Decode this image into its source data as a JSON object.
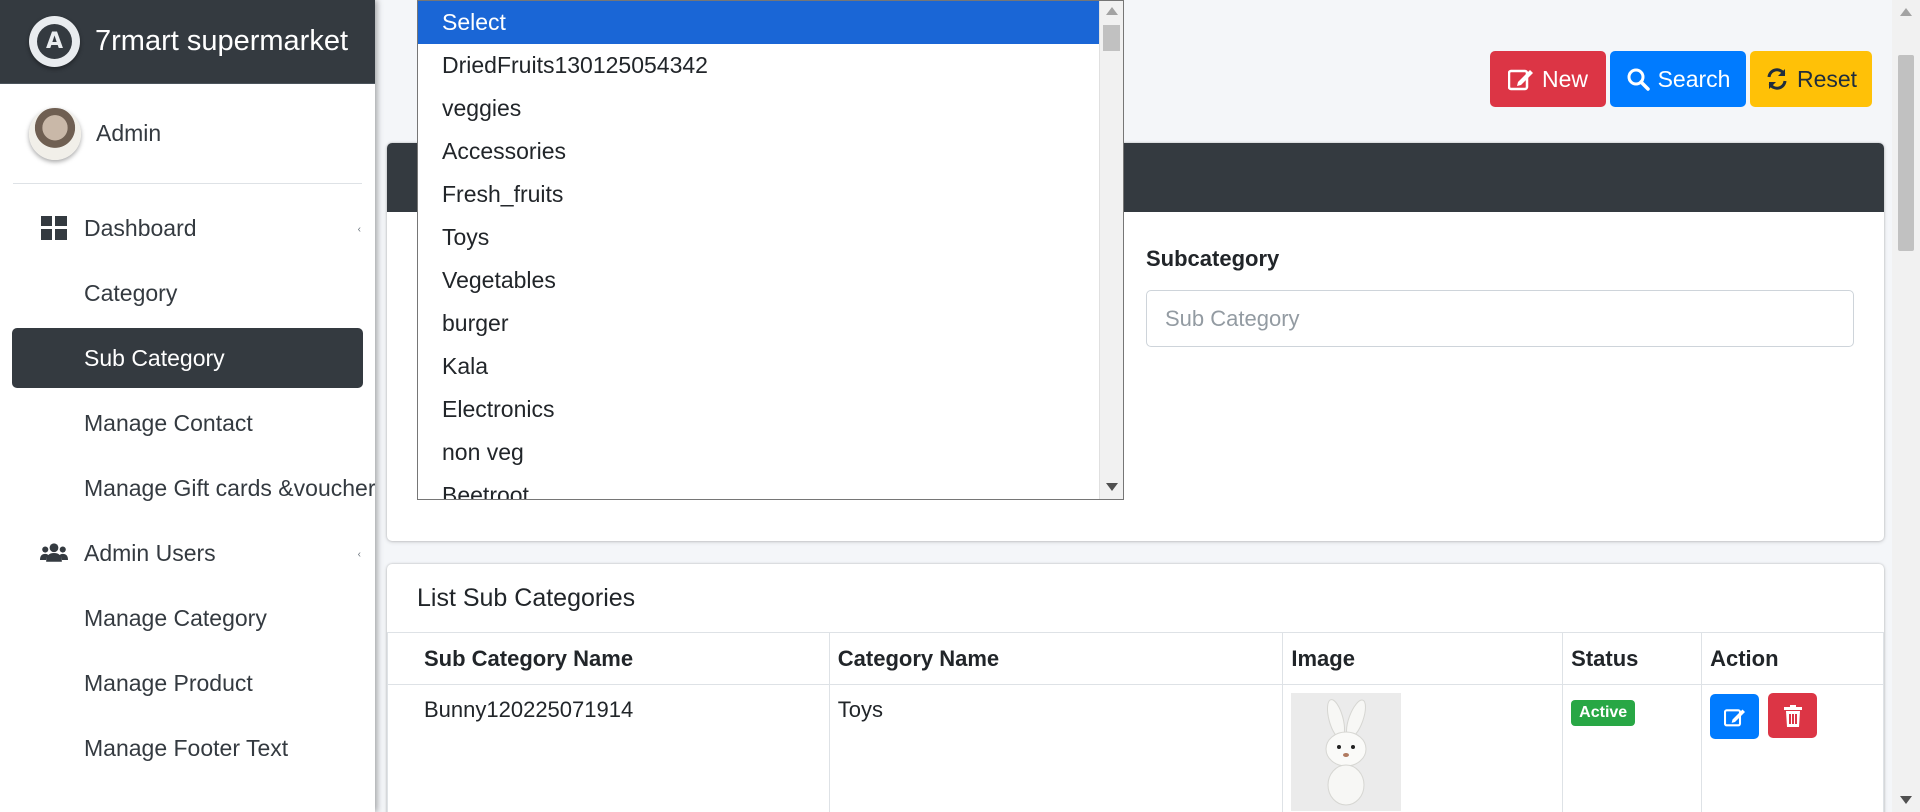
{
  "brand": {
    "name": "7rmart supermarket",
    "logo_letter": "A"
  },
  "user": {
    "name": "Admin"
  },
  "sidebar": {
    "items": [
      {
        "label": "Dashboard",
        "icon": "dashboard-icon",
        "level": "top"
      },
      {
        "label": "Category",
        "level": "sub"
      },
      {
        "label": "Sub Category",
        "level": "sub",
        "active": true
      },
      {
        "label": "Manage Contact",
        "level": "sub"
      },
      {
        "label": "Manage Gift cards &voucher",
        "level": "sub"
      },
      {
        "label": "Admin Users",
        "icon": "users-icon",
        "level": "top"
      },
      {
        "label": "Manage Category",
        "level": "sub"
      },
      {
        "label": "Manage Product",
        "level": "sub"
      },
      {
        "label": "Manage Footer Text",
        "level": "sub"
      }
    ]
  },
  "toolbar": {
    "new_label": "New",
    "search_label": "Search",
    "reset_label": "Reset"
  },
  "search_form": {
    "subcategory_label": "Subcategory",
    "subcategory_placeholder": "Sub Category",
    "category_dropdown": {
      "selected": "Select",
      "options": [
        "Select",
        "DriedFruits130125054342",
        "veggies",
        "Accessories",
        "Fresh_fruits",
        "Toys",
        "Vegetables",
        "burger",
        "Kala",
        "Electronics",
        "non veg",
        "Beetroot"
      ]
    }
  },
  "list": {
    "title": "List Sub Categories",
    "columns": [
      "Sub Category Name",
      "Category Name",
      "Image",
      "Status",
      "Action"
    ],
    "rows": [
      {
        "subcategory": "Bunny120225071914",
        "category": "Toys",
        "status": "Active"
      }
    ]
  },
  "colors": {
    "sidebar_dark": "#343a40",
    "primary": "#007bff",
    "danger": "#dc3545",
    "warning": "#ffc107",
    "success": "#28a745",
    "selected_option": "#1a66d6"
  }
}
